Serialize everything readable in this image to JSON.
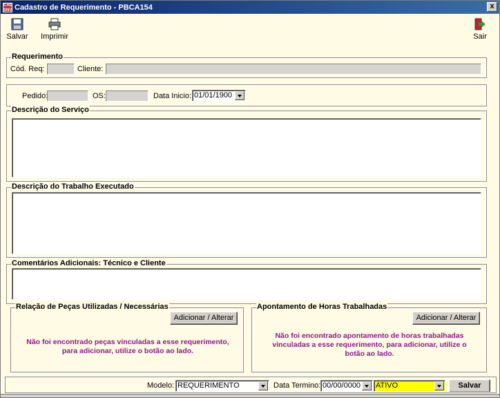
{
  "window": {
    "title": "Cadastro de Requerimento - PBCA154",
    "close_label": "x"
  },
  "toolbar": {
    "save_label": "Salvar",
    "print_label": "Imprimir",
    "exit_label": "Sair"
  },
  "requerimento": {
    "legend": "Requerimento",
    "cod_label": "Cód. Req:",
    "cod_value": "",
    "cliente_label": "Cliente:",
    "cliente_value": ""
  },
  "pedido": {
    "pedido_label": "Pedido:",
    "pedido_value": "",
    "os_label": "OS:",
    "os_value": "",
    "data_inicio_label": "Data Inicio:",
    "data_inicio_value": "01/01/1900"
  },
  "descricao_servico": {
    "legend": "Descrição do Serviço"
  },
  "descricao_trabalho": {
    "legend": "Descrição do Trabalho Executado"
  },
  "comentarios": {
    "legend": "Comentários Adicionais: Técnico e Cliente"
  },
  "pecas": {
    "legend": "Relação de Peças Utilizadas / Necessárias",
    "button": "Adicionar / Alterar",
    "message": "Não foi encontrado peças vinculadas a esse requerimento, para adicionar, utilize o botão ao lado."
  },
  "horas": {
    "legend": "Apontamento de Horas Trabalhadas",
    "button": "Adicionar / Alterar",
    "message": "Não foi encontrado apontamento de horas trabalhadas vinculadas a esse requerimento, para adicionar, utilize o botão ao lado."
  },
  "footer": {
    "modelo_label": "Modelo:",
    "modelo_value": "REQUERIMENTO",
    "data_termino_label": "Data Termino:",
    "data_termino_value": "00/00/0000",
    "status_value": "ATIVO",
    "status_color": "#ffff00",
    "save_label": "Salvar"
  },
  "colors": {
    "background": "#fffbe4",
    "message": "#8a1a8a",
    "titlebar": "#0a246a"
  }
}
